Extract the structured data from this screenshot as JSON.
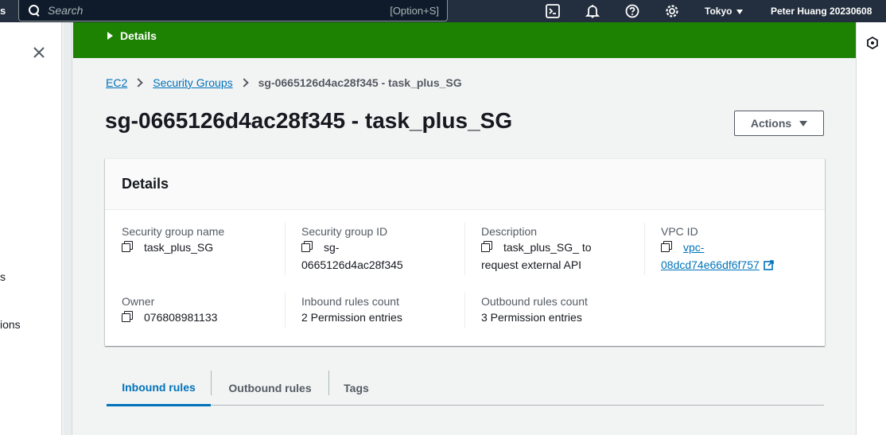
{
  "topnav": {
    "cut_label": "s",
    "search_placeholder": "Search",
    "search_shortcut": "[Option+S]",
    "region": "Tokyo",
    "user": "Peter Huang 20230608"
  },
  "sidenav": {
    "items": [
      "s",
      "ions"
    ]
  },
  "banner": {
    "toggle_label": "Details"
  },
  "breadcrumb": {
    "items": [
      "EC2",
      "Security Groups"
    ],
    "current": "sg-0665126d4ac28f345 - task_plus_SG"
  },
  "page": {
    "title": "sg-0665126d4ac28f345 - task_plus_SG",
    "actions_label": "Actions"
  },
  "details": {
    "header": "Details",
    "fields": {
      "sg_name": {
        "label": "Security group name",
        "value": "task_plus_SG"
      },
      "sg_id": {
        "label": "Security group ID",
        "value_line1": "sg-",
        "value_line2": "0665126d4ac28f345"
      },
      "description": {
        "label": "Description",
        "value_line1": "task_plus_SG_ to",
        "value_line2": "request external API"
      },
      "vpc_id": {
        "label": "VPC ID",
        "value_line1": "vpc-",
        "value_line2": "08dcd74e66df6f757"
      },
      "owner": {
        "label": "Owner",
        "value": "076808981133"
      },
      "inbound_count": {
        "label": "Inbound rules count",
        "value": "2 Permission entries"
      },
      "outbound_count": {
        "label": "Outbound rules count",
        "value": "3 Permission entries"
      }
    }
  },
  "tabs": [
    "Inbound rules",
    "Outbound rules",
    "Tags"
  ],
  "active_tab": "Inbound rules",
  "colors": {
    "nav_bg": "#232f3e",
    "banner_green": "#1d8102",
    "link_blue": "#0073bb"
  }
}
